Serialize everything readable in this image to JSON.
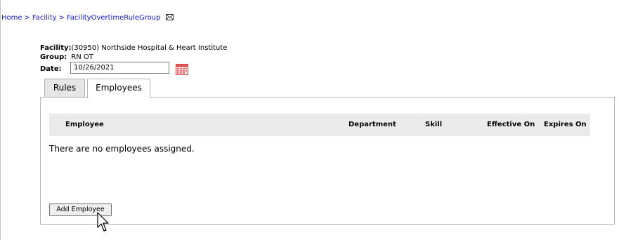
{
  "breadcrumb": {
    "items": [
      "Home",
      "Facility",
      "FacilityOvertimeRuleGroup"
    ],
    "separator": ">"
  },
  "info": {
    "facility_label": "Facility:",
    "facility_value": "(30950) Northside Hospital & Heart Institute",
    "group_label": "Group:",
    "group_value": "RN OT",
    "date_label": "Date:",
    "date_value": "10/26/2021"
  },
  "tabs": [
    {
      "label": "Rules",
      "active": false
    },
    {
      "label": "Employees",
      "active": true
    }
  ],
  "grid": {
    "columns": [
      "Employee",
      "Department",
      "Skill",
      "Effective On",
      "Expires On"
    ],
    "rows": [],
    "empty_message": "There are no employees assigned."
  },
  "actions": {
    "add_employee_label": "Add Employee"
  },
  "icons": {
    "breadcrumb_mail": "mail-icon",
    "date_picker": "calendar-icon",
    "pointer": "cursor-icon"
  },
  "colors": {
    "link": "#1a1acc",
    "header_bg": "#ebebeb",
    "calendar_accent": "#d9534f"
  }
}
